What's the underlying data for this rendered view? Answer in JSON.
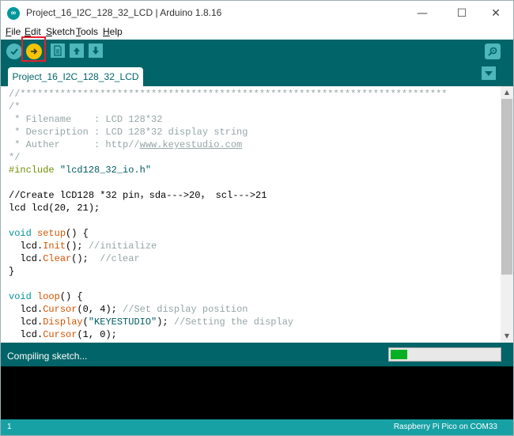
{
  "window": {
    "title": "Project_16_I2C_128_32_LCD | Arduino 1.8.16",
    "app_icon_text": "∞",
    "controls": [
      "—",
      "☐",
      "✕"
    ]
  },
  "menu": {
    "file": {
      "first": "F",
      "rest": "ile"
    },
    "edit": {
      "first": "E",
      "rest": "dit"
    },
    "sketch": {
      "first": "S",
      "rest": "ketch"
    },
    "tools": {
      "first": "T",
      "rest": "ools"
    },
    "help": {
      "first": "H",
      "rest": "elp"
    }
  },
  "toolbar": {
    "verify_icon": "checkmark-icon",
    "upload_icon": "arrow-right-icon",
    "new_icon": "document-icon",
    "open_icon": "arrow-up-icon",
    "save_icon": "arrow-down-icon",
    "serial_monitor_icon": "magnifier-icon",
    "upload_highlighted": true
  },
  "tabs": [
    {
      "label": "Project_16_I2C_128_32_LCD",
      "active": true
    }
  ],
  "code": {
    "l1": "//***************************************************************************",
    "l2": "/*",
    "l3": " * Filename    : LCD 128*32",
    "l4": " * Description : LCD 128*32 display string",
    "l5a": " * Auther      : http//",
    "l5b": "www.keyestudio.com",
    "l6": "*/",
    "l7a": "#include ",
    "l7b": "\"lcd128_32_io.h\"",
    "l8": "//Create lCD128 *32 pin，sda--->20， scl--->21",
    "l9": "lcd lcd(20, 21);",
    "l10a": "void",
    "l10b": " ",
    "l10c": "setup",
    "l10d": "() {",
    "l11a": "  lcd.",
    "l11b": "Init",
    "l11c": "(); ",
    "l11d": "//initialize",
    "l12a": "  lcd.",
    "l12b": "Clear",
    "l12c": "();  ",
    "l12d": "//clear",
    "l13": "}",
    "l14a": "void",
    "l14b": " ",
    "l14c": "loop",
    "l14d": "() {",
    "l15a": "  lcd.",
    "l15b": "Cursor",
    "l15c": "(0, 4); ",
    "l15d": "//Set display position",
    "l16a": "  lcd.",
    "l16b": "Display",
    "l16c": "(",
    "l16d": "\"KEYESTUDIO\"",
    "l16e": "); ",
    "l16f": "//Setting the display",
    "l17a": "  lcd.",
    "l17b": "Cursor",
    "l17c": "(1, 0);"
  },
  "status": {
    "message": "Compiling sketch...",
    "progress_fraction": 0.15
  },
  "footer": {
    "line_number": "1",
    "board": "Raspberry Pi Pico on COM33"
  },
  "colors": {
    "toolbar_bg": "#006468",
    "button_bg": "#4db7bb",
    "upload_button": "#f5c400",
    "highlight_box": "#e8202a",
    "footer_bg": "#17a1a5",
    "progress_fill": "#06b025"
  }
}
